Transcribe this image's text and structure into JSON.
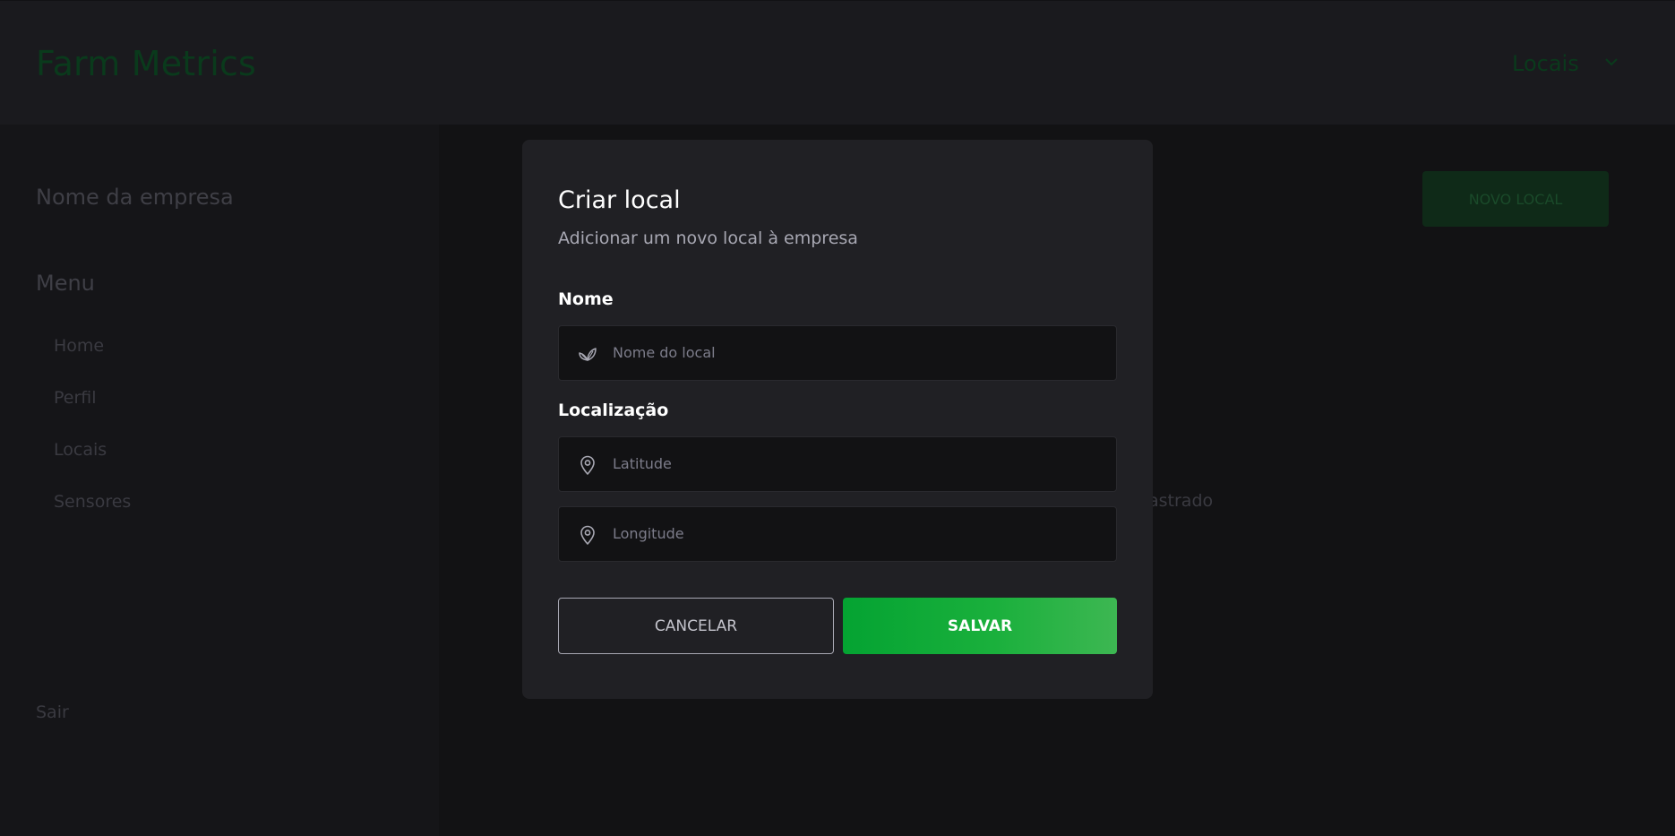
{
  "app": {
    "brand": "Farm Metrics"
  },
  "header": {
    "nav_label": "Locais",
    "chevron_icon": "chevron-down-icon"
  },
  "sidebar": {
    "company_name": "Nome da empresa",
    "menu_title": "Menu",
    "items": [
      {
        "label": "Home"
      },
      {
        "label": "Perfil"
      },
      {
        "label": "Locais"
      },
      {
        "label": "Sensores"
      }
    ],
    "logout_label": "Sair"
  },
  "main": {
    "new_local_label": "NOVO LOCAL",
    "empty_text": "astrado"
  },
  "modal": {
    "title": "Criar local",
    "subtitle": "Adicionar um novo local à empresa",
    "name_label": "Nome",
    "name_placeholder": "Nome do local",
    "name_icon": "leaf-icon",
    "location_label": "Localização",
    "latitude_placeholder": "Latitude",
    "longitude_placeholder": "Longitude",
    "location_icon": "map-pin-icon",
    "cancel_label": "CANCELAR",
    "save_label": "SALVAR"
  },
  "colors": {
    "background": "#121214",
    "modal": "#202024",
    "accent": "#04a332",
    "brand_dim": "#0a3a1c"
  }
}
